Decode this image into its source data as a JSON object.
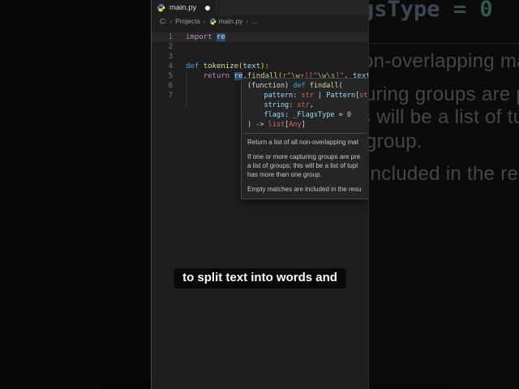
{
  "colors": {
    "syntax": {
      "plain": "#d4d4d4",
      "keyword": "#c586c0",
      "kwBlue": "#569cd6",
      "func": "#dcdcaa",
      "param": "#9cdcfe",
      "typeRed": "#d16969",
      "string": "#ce9178",
      "escape": "#d7ba7d",
      "regexOp": "#d16969",
      "number": "#b5cea8",
      "bracket": "#ffd700",
      "wordHighlight": "#264f78"
    },
    "tooltipBg": "#252526",
    "tooltipBorder": "#454545",
    "editorBg": "#1e1e1e",
    "tabStripBg": "#252526"
  },
  "window": {
    "tab_label": "main.py",
    "modified": true,
    "breadcrumb": {
      "items": [
        "C:",
        "Projects",
        "main.py",
        "..."
      ],
      "separator": "›"
    }
  },
  "editor": {
    "lines": [
      {
        "num": "1",
        "current": true,
        "tokens": [
          {
            "t": "import ",
            "c": "keyword"
          },
          {
            "t": "re",
            "c": "plain",
            "bg": "wordHighlight"
          }
        ]
      },
      {
        "num": "2",
        "tokens": []
      },
      {
        "num": "3",
        "tokens": []
      },
      {
        "num": "4",
        "tokens": [
          {
            "t": "def ",
            "c": "kwBlue"
          },
          {
            "t": "tokenize",
            "c": "func"
          },
          {
            "t": "(",
            "c": "bracket"
          },
          {
            "t": "text",
            "c": "param"
          },
          {
            "t": ")",
            "c": "bracket"
          },
          {
            "t": ":",
            "c": "plain"
          }
        ]
      },
      {
        "num": "5",
        "tokens": [
          {
            "t": "    ",
            "c": "plain"
          },
          {
            "t": "return ",
            "c": "keyword"
          },
          {
            "t": "re",
            "c": "plain",
            "bg": "wordHighlight"
          },
          {
            "t": ".",
            "c": "plain"
          },
          {
            "t": "findall",
            "c": "func"
          },
          {
            "t": "(",
            "c": "bracket"
          },
          {
            "t": "r\"",
            "c": "string"
          },
          {
            "t": "\\w",
            "c": "escape"
          },
          {
            "t": "+|[^",
            "c": "regexOp"
          },
          {
            "t": "\\w\\s",
            "c": "escape"
          },
          {
            "t": "]",
            "c": "regexOp"
          },
          {
            "t": "\"",
            "c": "string"
          },
          {
            "t": ", ",
            "c": "plain"
          },
          {
            "t": "text",
            "c": "param"
          },
          {
            "t": ")",
            "c": "bracket"
          }
        ]
      },
      {
        "num": "6",
        "tokens": []
      },
      {
        "num": "7",
        "tokens": []
      }
    ]
  },
  "tooltip": {
    "signature_lines": [
      [
        {
          "t": "(function) ",
          "c": "plain"
        },
        {
          "t": "def ",
          "c": "kwBlue"
        },
        {
          "t": "findall",
          "c": "func"
        },
        {
          "t": "(",
          "c": "plain"
        }
      ],
      [
        {
          "t": "    pattern",
          "c": "param"
        },
        {
          "t": ": ",
          "c": "plain"
        },
        {
          "t": "str",
          "c": "typeRed"
        },
        {
          "t": " | ",
          "c": "plain"
        },
        {
          "t": "Pattern",
          "c": "param"
        },
        {
          "t": "[",
          "c": "plain"
        },
        {
          "t": "str",
          "c": "typeRed"
        },
        {
          "t": "],",
          "c": "plain"
        }
      ],
      [
        {
          "t": "    string",
          "c": "param"
        },
        {
          "t": ": ",
          "c": "plain"
        },
        {
          "t": "str",
          "c": "typeRed"
        },
        {
          "t": ",",
          "c": "plain"
        }
      ],
      [
        {
          "t": "    flags",
          "c": "param"
        },
        {
          "t": ": ",
          "c": "plain"
        },
        {
          "t": "_FlagsType",
          "c": "param"
        },
        {
          "t": " = ",
          "c": "plain"
        },
        {
          "t": "0",
          "c": "number"
        }
      ],
      [
        {
          "t": ") -> ",
          "c": "plain"
        },
        {
          "t": "list",
          "c": "typeRed"
        },
        {
          "t": "[",
          "c": "plain"
        },
        {
          "t": "Any",
          "c": "typeRed"
        },
        {
          "t": "]",
          "c": "plain"
        }
      ]
    ],
    "doc_paragraphs": [
      [
        "Return a list of all non-overlapping mat"
      ],
      [
        "If one or more capturing groups are pre",
        "a list of groups; this will be a list of tupl",
        "has more than one group."
      ],
      [
        "Empty matches are included in the resu"
      ]
    ]
  },
  "caption": {
    "text": "to split text into words and"
  },
  "background": {
    "top_code": {
      "t1": "gsType",
      "t2": "=",
      "t3": "0"
    },
    "texts": [
      "on-overlapping mat",
      "turing groups are pre",
      "s will be a list of tupl",
      "group.",
      "included in the resu"
    ]
  }
}
